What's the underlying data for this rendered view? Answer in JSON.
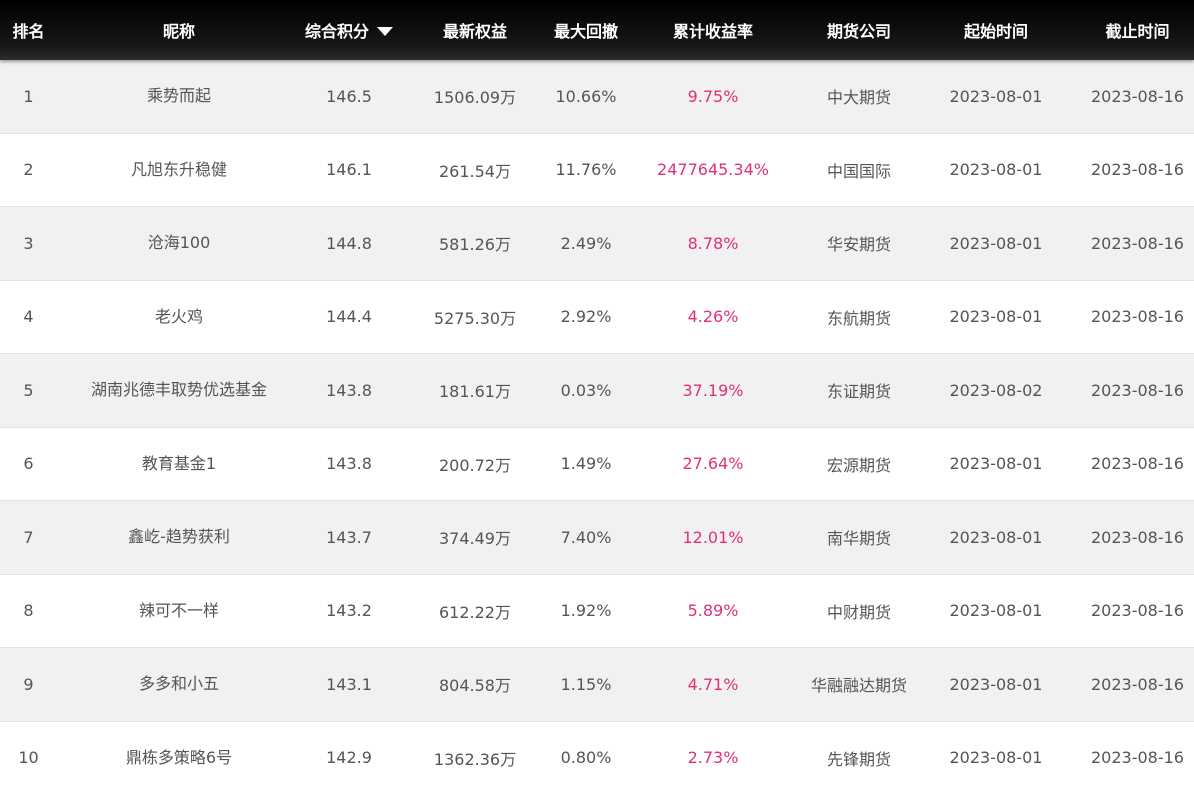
{
  "header": {
    "rank": "排名",
    "name": "昵称",
    "score": "综合积分",
    "equity": "最新权益",
    "drawdown": "最大回撤",
    "return": "累计收益率",
    "firm": "期货公司",
    "start": "起始时间",
    "end": "截止时间",
    "sort_icon": "sort-down-triangle"
  },
  "colors": {
    "header_bg": "#000000",
    "return_text": "#e0307a",
    "row_alt_bg": "#f1f1f1"
  },
  "rows": [
    {
      "rank": "1",
      "name": "乘势而起",
      "score": "146.5",
      "equity": "1506.09万",
      "drawdown": "10.66%",
      "return": "9.75%",
      "firm": "中大期货",
      "start": "2023-08-01",
      "end": "2023-08-16"
    },
    {
      "rank": "2",
      "name": "凡旭东升稳健",
      "score": "146.1",
      "equity": "261.54万",
      "drawdown": "11.76%",
      "return": "2477645.34%",
      "firm": "中国国际",
      "start": "2023-08-01",
      "end": "2023-08-16"
    },
    {
      "rank": "3",
      "name": "沧海100",
      "score": "144.8",
      "equity": "581.26万",
      "drawdown": "2.49%",
      "return": "8.78%",
      "firm": "华安期货",
      "start": "2023-08-01",
      "end": "2023-08-16"
    },
    {
      "rank": "4",
      "name": "老火鸡",
      "score": "144.4",
      "equity": "5275.30万",
      "drawdown": "2.92%",
      "return": "4.26%",
      "firm": "东航期货",
      "start": "2023-08-01",
      "end": "2023-08-16"
    },
    {
      "rank": "5",
      "name": "湖南兆德丰取势优选基金",
      "score": "143.8",
      "equity": "181.61万",
      "drawdown": "0.03%",
      "return": "37.19%",
      "firm": "东证期货",
      "start": "2023-08-02",
      "end": "2023-08-16"
    },
    {
      "rank": "6",
      "name": "教育基金1",
      "score": "143.8",
      "equity": "200.72万",
      "drawdown": "1.49%",
      "return": "27.64%",
      "firm": "宏源期货",
      "start": "2023-08-01",
      "end": "2023-08-16"
    },
    {
      "rank": "7",
      "name": "鑫屹-趋势获利",
      "score": "143.7",
      "equity": "374.49万",
      "drawdown": "7.40%",
      "return": "12.01%",
      "firm": "南华期货",
      "start": "2023-08-01",
      "end": "2023-08-16"
    },
    {
      "rank": "8",
      "name": "辣可不一样",
      "score": "143.2",
      "equity": "612.22万",
      "drawdown": "1.92%",
      "return": "5.89%",
      "firm": "中财期货",
      "start": "2023-08-01",
      "end": "2023-08-16"
    },
    {
      "rank": "9",
      "name": "多多和小五",
      "score": "143.1",
      "equity": "804.58万",
      "drawdown": "1.15%",
      "return": "4.71%",
      "firm": "华融融达期货",
      "start": "2023-08-01",
      "end": "2023-08-16"
    },
    {
      "rank": "10",
      "name": "鼎栋多策略6号",
      "score": "142.9",
      "equity": "1362.36万",
      "drawdown": "0.80%",
      "return": "2.73%",
      "firm": "先锋期货",
      "start": "2023-08-01",
      "end": "2023-08-16"
    }
  ]
}
